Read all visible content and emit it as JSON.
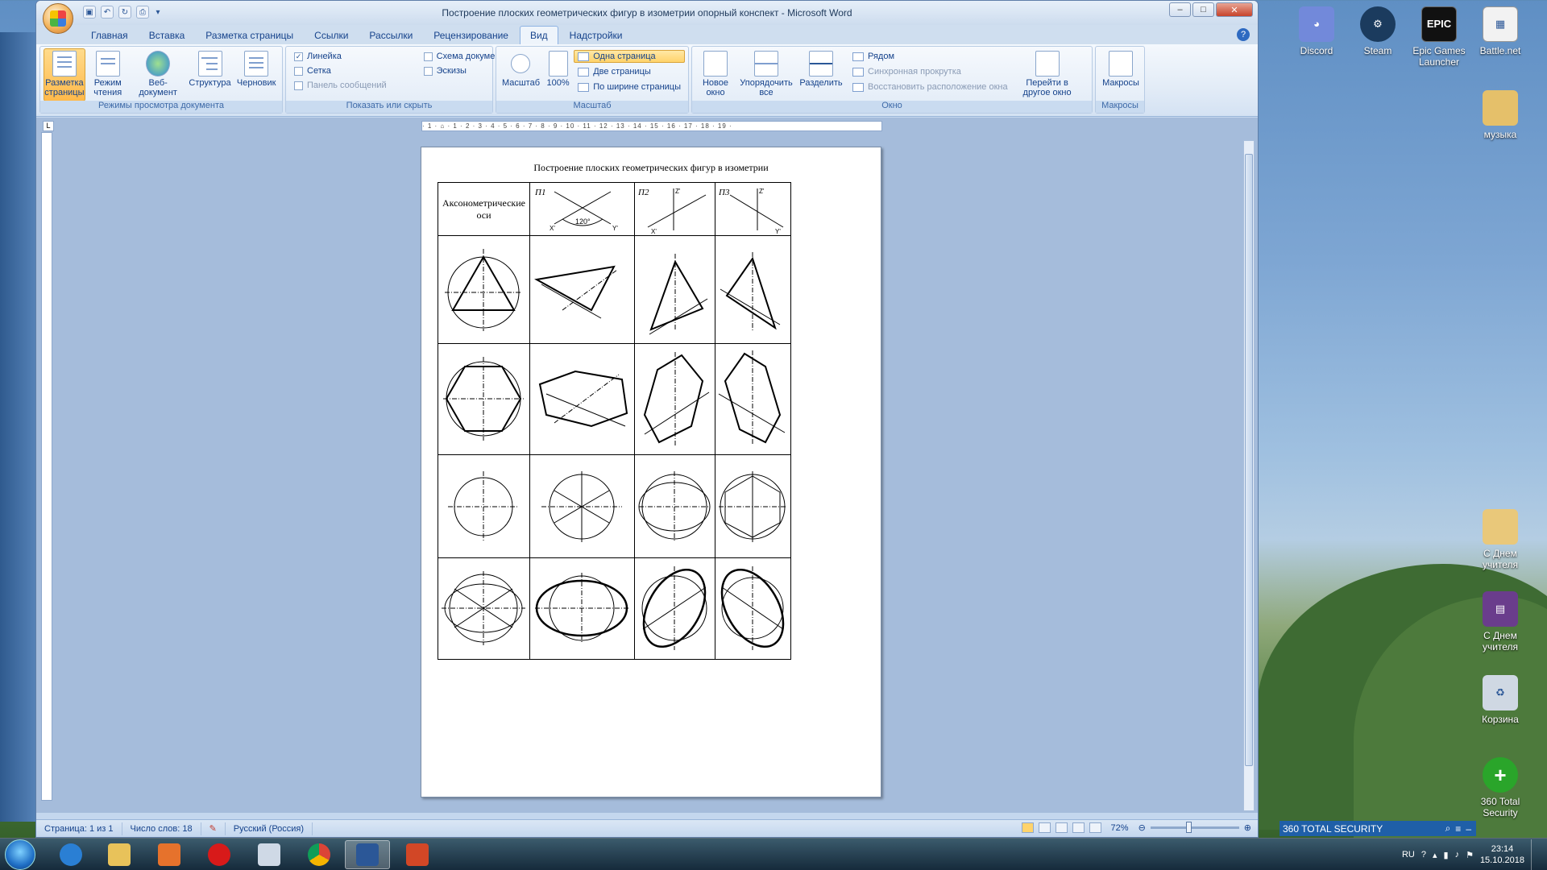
{
  "window": {
    "title": "Построение плоских геометрических фигур в изометрии опорный конспект - Microsoft Word",
    "controls": {
      "minimize": "–",
      "maximize": "□",
      "close": "✕"
    }
  },
  "qat": [
    "save",
    "undo",
    "redo",
    "print-preview"
  ],
  "tabs": [
    "Главная",
    "Вставка",
    "Разметка страницы",
    "Ссылки",
    "Рассылки",
    "Рецензирование",
    "Вид",
    "Надстройки"
  ],
  "active_tab": "Вид",
  "ribbon": {
    "views": {
      "label": "Режимы просмотра документа",
      "buttons": [
        "Разметка страницы",
        "Режим чтения",
        "Веб-документ",
        "Структура",
        "Черновик"
      ]
    },
    "show_hide": {
      "label": "Показать или скрыть",
      "col1": [
        {
          "label": "Линейка",
          "checked": true,
          "disabled": false
        },
        {
          "label": "Сетка",
          "checked": false,
          "disabled": false
        },
        {
          "label": "Панель сообщений",
          "checked": false,
          "disabled": true
        }
      ],
      "col2": [
        {
          "label": "Схема документа",
          "checked": false,
          "disabled": false
        },
        {
          "label": "Эскизы",
          "checked": false,
          "disabled": false
        }
      ]
    },
    "zoom": {
      "label": "Масштаб",
      "zoom_btn": "Масштаб",
      "hundred_btn": "100%",
      "small": [
        "Одна страница",
        "Две страницы",
        "По ширине страницы"
      ]
    },
    "window": {
      "label": "Окно",
      "big": [
        "Новое окно",
        "Упорядочить все",
        "Разделить"
      ],
      "small": [
        "Рядом",
        "Синхронная прокрутка",
        "Восстановить расположение окна"
      ],
      "switch": "Перейти в другое окно"
    },
    "macros": {
      "label": "Макросы",
      "btn": "Макросы"
    }
  },
  "ruler_text": "· 1 · ⌂ · 1 · 2 · 3 · 4 · 5 · 6 · 7 · 8 · 9 · 10 · 11 · 12 · 13 · 14 · 15 · 16 · 17 · 18 · 19 ·",
  "tab_selector": "L",
  "document": {
    "title": "Построение плоских геометрических фигур  в изометрии",
    "header_cell": "Аксонометрические оси",
    "plane_labels": [
      "П1",
      "П2",
      "П3"
    ],
    "axis_labels": {
      "x": "X'",
      "y": "Y'",
      "z": "Z'"
    },
    "angle": "120°"
  },
  "statusbar": {
    "page": "Страница: 1 из 1",
    "words": "Число слов: 18",
    "lang": "Русский (Россия)",
    "zoom": "72%"
  },
  "desktop_icons": [
    {
      "label": "Discord",
      "color": "#7289da"
    },
    {
      "label": "Steam",
      "color": "#1b3b5e"
    },
    {
      "label": "Epic Games Launcher",
      "color": "#111111"
    },
    {
      "label": "Battle.net",
      "color": "#f2f2f2"
    },
    {
      "label": "музыка",
      "color": "#e5c06a"
    },
    {
      "label": "С Днем учителя",
      "color": "#e9c87a"
    },
    {
      "label": "С Днем учителя",
      "color": "#6a3d8c"
    },
    {
      "label": "Корзина",
      "color": "#cfd8e3"
    },
    {
      "label": "360 Total Security",
      "color": "#2aa52a"
    }
  ],
  "epic_icon_text": "EPIC",
  "security_bar": "360 TOTAL SECURITY",
  "tray": {
    "lang": "RU",
    "time": "23:14",
    "date": "15.10.2018"
  },
  "taskbar_colors": [
    "#2a7fd4",
    "#e8c25a",
    "#e6722c",
    "#d81a1a",
    "#cfd9e6",
    "#3aa04a",
    "#2b5797",
    "#d24726"
  ]
}
